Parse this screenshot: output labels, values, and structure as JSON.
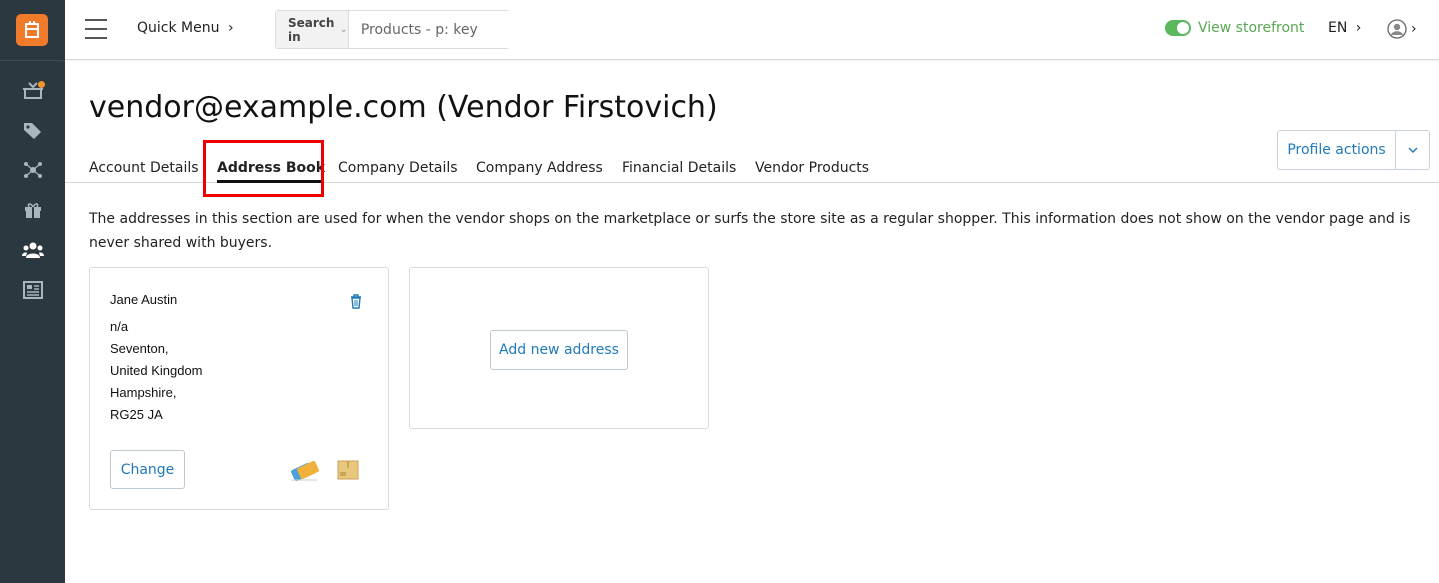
{
  "topbar": {
    "quick_menu": "Quick Menu",
    "search_in": "Search in",
    "search_placeholder": "Products - p: key",
    "view_storefront": "View storefront",
    "language": "EN"
  },
  "page": {
    "title": "vendor@example.com (Vendor Firstovich)",
    "profile_actions": "Profile actions",
    "tabs": [
      {
        "label": "Account Details",
        "active": false
      },
      {
        "label": "Address Book",
        "active": true
      },
      {
        "label": "Company Details",
        "active": false
      },
      {
        "label": "Company Address",
        "active": false
      },
      {
        "label": "Financial Details",
        "active": false
      },
      {
        "label": "Vendor Products",
        "active": false
      }
    ],
    "description": "The addresses in this section are used for when the vendor shops on the marketplace or surfs the store site as a regular shopper. This information does not show on the vendor page and is never shared with buyers."
  },
  "address": {
    "name": "Jane Austin",
    "lines": [
      "n/a",
      "Seventon,",
      "United Kingdom",
      "Hampshire,",
      "RG25 JA"
    ],
    "change_label": "Change"
  },
  "new_address": {
    "label": "Add new address"
  },
  "colors": {
    "accent": "#1f7ab8",
    "rail": "#2c3840",
    "logo": "#f07b2c",
    "storefront": "#57a84f",
    "highlight": "#ee0000"
  },
  "icons": {
    "rail": [
      "orders-icon",
      "tags-icon",
      "network-icon",
      "gift-icon",
      "users-icon",
      "news-icon"
    ]
  }
}
